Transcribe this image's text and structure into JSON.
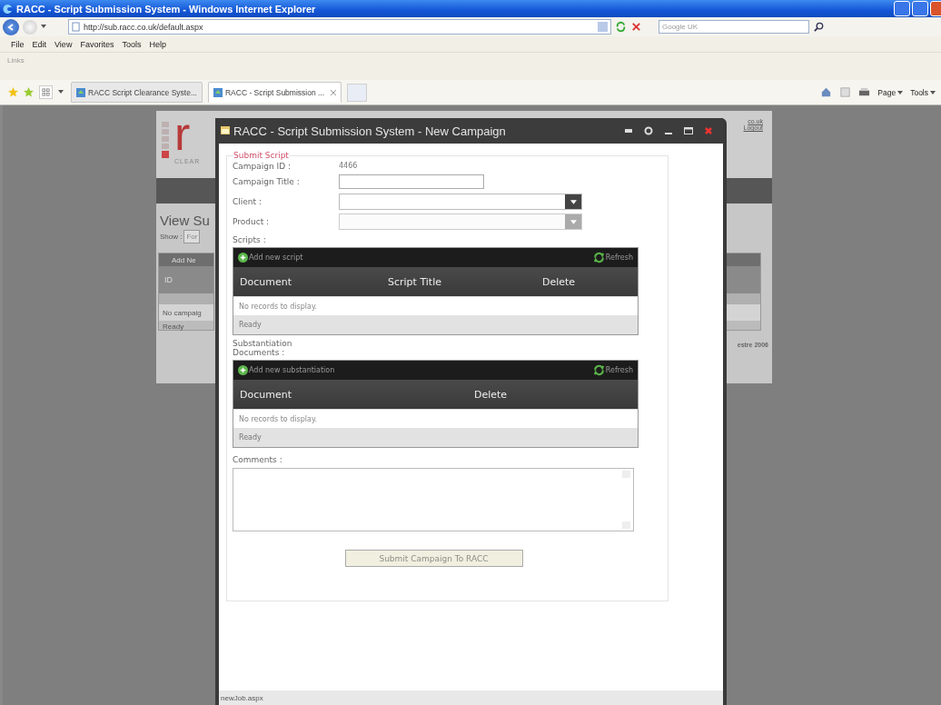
{
  "browser": {
    "title": "RACC - Script Submission System - Windows Internet Explorer",
    "address": "http://sub.racc.co.uk/default.aspx",
    "search_placeholder": "Google UK",
    "menu": [
      "File",
      "Edit",
      "View",
      "Favorites",
      "Tools",
      "Help"
    ],
    "links_label": "Links",
    "tabs": [
      {
        "label": "RACC Script Clearance Syste...",
        "selected": false
      },
      {
        "label": "RACC - Script Submission ...",
        "selected": true
      }
    ],
    "command_bar": [
      "Page",
      "Tools"
    ]
  },
  "background_page": {
    "logo_letter": "r",
    "logo_caption": "CLEAR",
    "header_links": [
      "co.uk",
      "Logout"
    ],
    "heading": "View Su",
    "show_label": "Show :",
    "show_value": "For",
    "grid_toolbar": "Add Ne",
    "grid_column": "ID",
    "grid_empty": "No campaig",
    "grid_status": "Ready",
    "footer": "estre 2006"
  },
  "dialog": {
    "title": "RACC - Script Submission System - New Campaign",
    "legend": "Submit Script",
    "fields": [
      {
        "kind": "text",
        "label": "Campaign ID :",
        "value": "4466"
      },
      {
        "kind": "input",
        "label": "Campaign Title :"
      },
      {
        "kind": "select",
        "label": "Client :",
        "disabled": false
      },
      {
        "kind": "select",
        "label": "Product :",
        "disabled": true
      }
    ],
    "grids": [
      {
        "label": "Scripts :",
        "add_label": "Add new script",
        "refresh_label": "Refresh",
        "columns": [
          "Document",
          "Script Title",
          "Delete"
        ],
        "empty": "No records to display.",
        "status": "Ready"
      },
      {
        "label": "Substantiation Documents :",
        "add_label": "Add new substantiation",
        "refresh_label": "Refresh",
        "columns": [
          "Document",
          "Delete"
        ],
        "empty": "No records to display.",
        "status": "Ready"
      }
    ],
    "comments_label": "Comments :",
    "submit": {
      "label": "Submit Campaign To RACC",
      "disabled": true
    },
    "status_bar": "newJob.aspx"
  }
}
